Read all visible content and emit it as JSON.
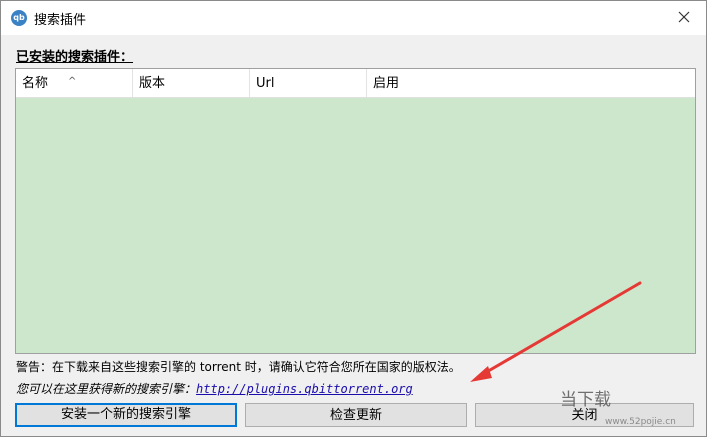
{
  "window": {
    "icon_text": "qb",
    "title": "搜索插件",
    "close_glyph": "×"
  },
  "section": {
    "label": "已安装的搜索插件："
  },
  "table": {
    "columns": [
      "名称",
      "版本",
      "Url",
      "启用"
    ],
    "sort_indicator": "^",
    "rows": [],
    "background": "#cde7cc"
  },
  "footer": {
    "warning": "警告：在下载来自这些搜索引擎的 torrent 时，请确认它符合您所在国家的版权法。",
    "hint_prefix": "您可以在这里获得新的搜索引擎：",
    "hint_link": "http://plugins.qbittorrent.org"
  },
  "buttons": {
    "install": "安装一个新的搜索引擎",
    "check_updates": "检查更新",
    "close": "关闭"
  },
  "overlay": {
    "watermark": "当下载",
    "watermark_url": "www.52pojie.cn",
    "arrow_color": "#e53935"
  }
}
